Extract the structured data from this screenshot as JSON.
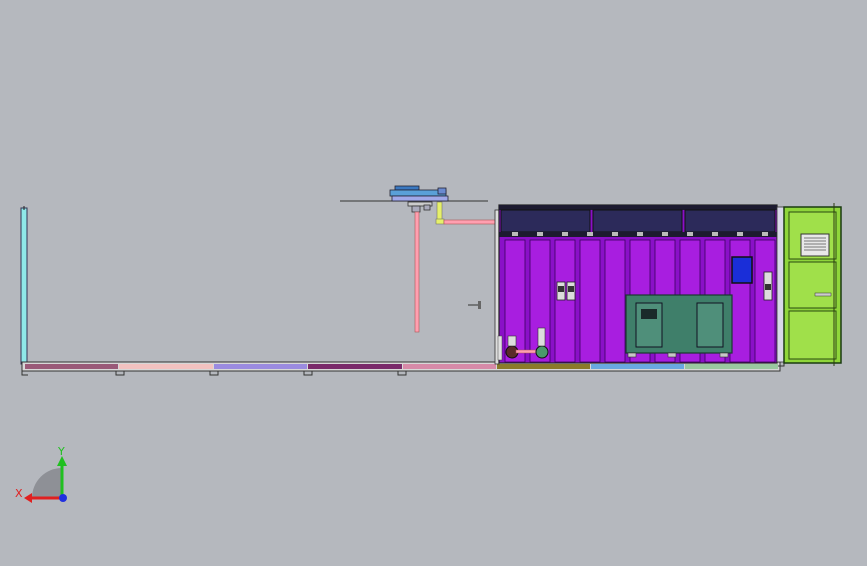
{
  "axis_triad": {
    "x_label": "X",
    "y_label": "Y"
  },
  "colors": {
    "background": "#b5b8be",
    "cabinet_body": "#8a10c8",
    "cabinet_panel": "#a81ee0",
    "cabinet_top": "#2c2a5a",
    "equipment_unit": "#3f7f6a",
    "door_panel": "#8fd63a",
    "left_post": "#8fe8e8",
    "pipe_pink": "#ff9fb0",
    "pipe_yellow": "#e6f06a",
    "top_unit": "#3a78c0",
    "x_axis": "#e02020",
    "y_axis": "#20c020",
    "z_axis": "#2030e0"
  },
  "base_segments": [
    {
      "name": "segment-1",
      "color": "#9a5a78"
    },
    {
      "name": "segment-2",
      "color": "#f3c2c0"
    },
    {
      "name": "segment-3",
      "color": "#9b8be0"
    },
    {
      "name": "segment-4",
      "color": "#7a2a6a"
    },
    {
      "name": "segment-5",
      "color": "#d78aa8"
    },
    {
      "name": "segment-6",
      "color": "#8a7a2a"
    },
    {
      "name": "segment-7",
      "color": "#6aa8e0"
    },
    {
      "name": "segment-8",
      "color": "#9ac8a0"
    }
  ]
}
